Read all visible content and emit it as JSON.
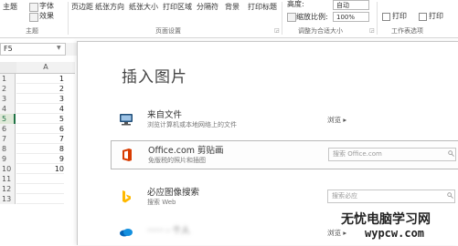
{
  "ribbon": {
    "theme_label": "主题",
    "font_label": "字体",
    "effects_label": "效果",
    "margins_label": "页边距",
    "orientation_label": "纸张方向",
    "size_label": "纸张大小",
    "print_area_label": "打印区域",
    "breaks_label": "分隔符",
    "background_label": "背景",
    "print_titles_label": "打印标题",
    "height_label": "高度:",
    "height_value": "自动",
    "scale_label": "缩放比例:",
    "scale_value": "100%",
    "gridlines_print_label": "打印",
    "headings_print_label": "打印",
    "groups": {
      "theme": "主题",
      "page_setup": "页面设置",
      "scale_to_fit": "调整为合适大小",
      "sheet_options": "工作表选项"
    }
  },
  "namebox": {
    "value": "F5"
  },
  "sheet": {
    "column_header": "A",
    "rows": [
      {
        "num": "1",
        "value": "1"
      },
      {
        "num": "2",
        "value": "2"
      },
      {
        "num": "3",
        "value": "3"
      },
      {
        "num": "4",
        "value": "4"
      },
      {
        "num": "5",
        "value": "5"
      },
      {
        "num": "6",
        "value": "6"
      },
      {
        "num": "7",
        "value": "7"
      },
      {
        "num": "8",
        "value": "8"
      },
      {
        "num": "9",
        "value": "9"
      },
      {
        "num": "10",
        "value": "10"
      },
      {
        "num": "11",
        "value": ""
      },
      {
        "num": "12",
        "value": ""
      },
      {
        "num": "13",
        "value": ""
      }
    ]
  },
  "dialog": {
    "title": "插入图片",
    "options": [
      {
        "name": "来自文件",
        "desc": "浏览计算机或本地网络上的文件",
        "action": "浏览 ▸",
        "icon": "computer-icon"
      },
      {
        "name": "Office.com 剪贴画",
        "desc": "免版税的照片和插图",
        "placeholder": "搜索 Office.com",
        "icon": "office-icon"
      },
      {
        "name": "必应图像搜索",
        "desc": "搜索 Web",
        "placeholder": "搜索必应",
        "icon": "bing-icon"
      },
      {
        "name": "······ - 个人",
        "desc": "",
        "action": "浏览 ▸",
        "icon": "onedrive-icon"
      }
    ]
  },
  "watermark": {
    "line1": "无忧电脑学习网",
    "line2": "wypcw.com"
  },
  "colors": {
    "accent": "#217346",
    "office_orange": "#d83b01",
    "bing_yellow": "#ffb900",
    "onedrive_blue": "#0364b8"
  }
}
